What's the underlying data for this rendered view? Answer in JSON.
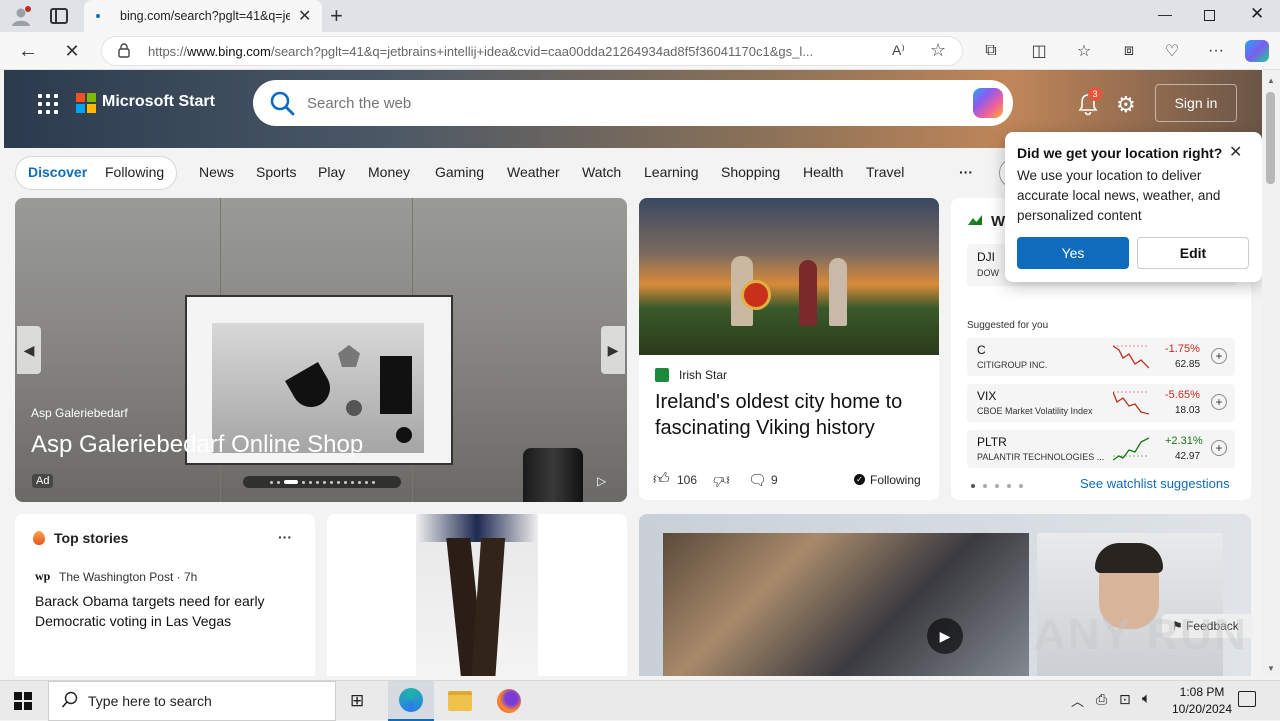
{
  "browser": {
    "tab_title": "bing.com/search?pglt=41&q=jet",
    "url_prefix": "https://",
    "url_domain": "www.bing.com",
    "url_rest": "/search?pglt=41&q=jetbrains+intellij+idea&cvid=caa00dda21264934ad8f5f36041170c1&gs_l..."
  },
  "header": {
    "brand": "Microsoft Start",
    "search_placeholder": "Search the web",
    "notif_count": "3",
    "sign_in": "Sign in"
  },
  "nav": {
    "discover": "Discover",
    "following": "Following",
    "tabs": [
      "News",
      "Sports",
      "Play",
      "Money",
      "Gaming",
      "Weather",
      "Watch",
      "Learning",
      "Shopping",
      "Health",
      "Travel"
    ],
    "more": "···"
  },
  "hero": {
    "source": "Asp Galeriebedarf",
    "title": "Asp Galeriebedarf Online Shop",
    "ad": "Ad"
  },
  "article": {
    "source": "Irish Star",
    "title": "Ireland's oldest city home to fascinating Viking history",
    "likes": "106",
    "comments": "9",
    "following": "Following"
  },
  "watchlist": {
    "title_initial": "W",
    "dji_symbol": "DJI",
    "dji_name": "DOW",
    "suggested_label": "Suggested for you",
    "stocks": [
      {
        "symbol": "C",
        "name": "CITIGROUP INC.",
        "change": "-1.75%",
        "price": "62.85",
        "color": "#c42b1c"
      },
      {
        "symbol": "VIX",
        "name": "CBOE Market Volatility Index",
        "change": "-5.65%",
        "price": "18.03",
        "color": "#c42b1c"
      },
      {
        "symbol": "PLTR",
        "name": "PALANTIR TECHNOLOGIES ...",
        "change": "+2.31%",
        "price": "42.97",
        "color": "#0e7a0d"
      }
    ],
    "see_suggestions": "See watchlist suggestions"
  },
  "location_popup": {
    "title": "Did we get your location right?",
    "body": "We use your location to deliver accurate local news, weather, and personalized content",
    "yes": "Yes",
    "edit": "Edit"
  },
  "top_stories": {
    "title": "Top stories",
    "more": "···",
    "source": "The Washington Post · 7h",
    "headline": "Barack Obama targets need for early Democratic voting in Las Vegas"
  },
  "feedback": "Feedback",
  "watermark": "ANY RUN",
  "taskbar": {
    "search_placeholder": "Type here to search",
    "time": "1:08 PM",
    "date": "10/20/2024"
  }
}
